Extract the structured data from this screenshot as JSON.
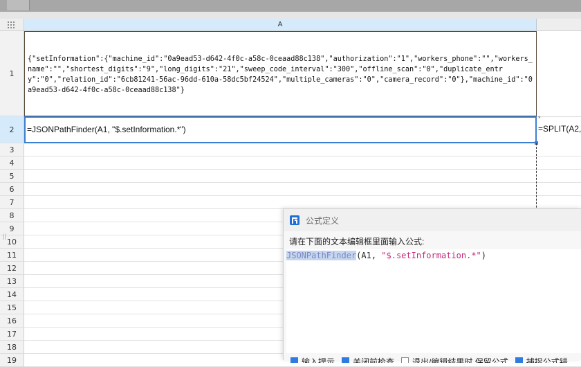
{
  "columns": {
    "a": "A"
  },
  "rows": [
    "1",
    "2",
    "3",
    "4",
    "5",
    "6",
    "7",
    "8",
    "9",
    "10",
    "11",
    "12",
    "13",
    "14",
    "15",
    "16",
    "17",
    "18",
    "19"
  ],
  "cells": {
    "a1": "{\"setInformation\":{\"machine_id\":\"0a9ead53-d642-4f0c-a58c-0ceaad88c138\",\"authorization\":\"1\",\"workers_phone\":\"\",\"workers_name\":\"\",\"shortest_digits\":\"9\",\"long_digits\":\"21\",\"sweep_code_interval\":\"300\",\"offline_scan\":\"0\",\"duplicate_entry\":\"0\",\"relation_id\":\"6cb81241-56ac-96dd-610a-58dc5bf24524\",\"multiple_cameras\":\"0\",\"camera_record\":\"0\"},\"machine_id\":\"0a9ead53-d642-4f0c-a58c-0ceaad88c138\"}",
    "a2": "=JSONPathFinder(A1, \"$.setInformation.*\")",
    "b2": "=SPLIT(A2,",
    "b2_marker": "*"
  },
  "dialog": {
    "title": "公式定义",
    "prompt": "请在下面的文本编辑框里面输入公式:",
    "formula_fn": "JSONPathFinder",
    "formula_mid": "(A1, ",
    "formula_str": "\"$.setInformation.*\"",
    "formula_end": ")",
    "options": [
      {
        "label": "输入提示",
        "checked": true
      },
      {
        "label": "关闭前检查",
        "checked": true
      },
      {
        "label": "退出/编辑结果时 保留公式",
        "checked": false
      },
      {
        "label": "捕捉公式错",
        "checked": true
      }
    ]
  },
  "colors": {
    "selection": "#3b7fd3",
    "header_selected": "#d5ebfb",
    "string": "#c4287c"
  }
}
